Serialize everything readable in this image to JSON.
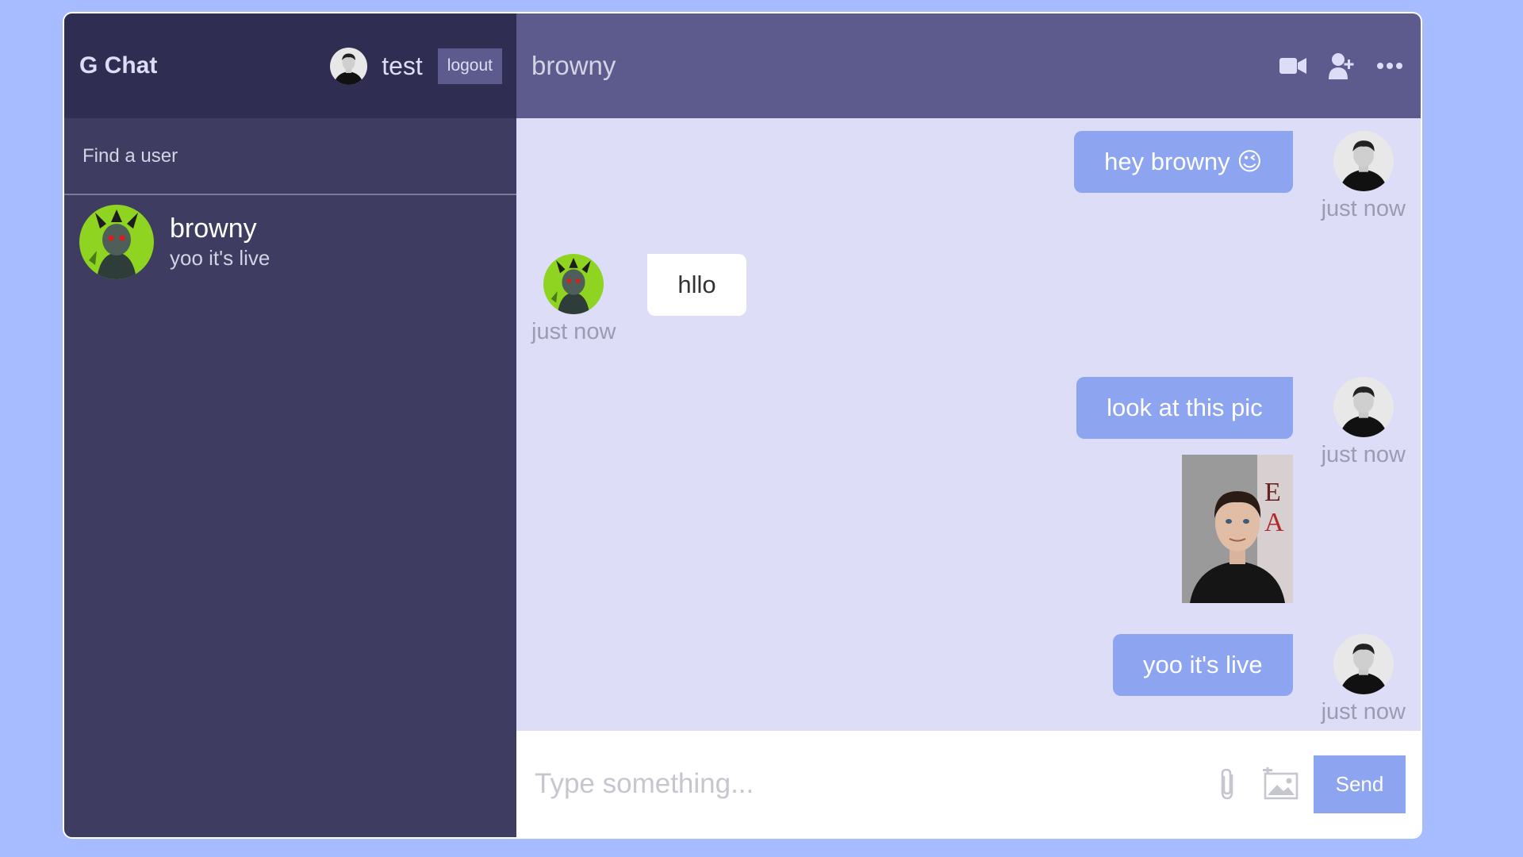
{
  "sidebar": {
    "app_title": "G Chat",
    "current_user": {
      "name": "test"
    },
    "logout_label": "logout",
    "search_placeholder": "Find a user",
    "chats": [
      {
        "name": "browny",
        "last_message": "yoo it's live"
      }
    ]
  },
  "chat": {
    "title": "browny",
    "icons": [
      "video-camera-icon",
      "add-user-icon",
      "more-options-icon"
    ],
    "messages": [
      {
        "owner": true,
        "text": "hey browny 😉",
        "time": "just now"
      },
      {
        "owner": false,
        "text": "hllo",
        "time": "just now"
      },
      {
        "owner": true,
        "text": "look at this pic",
        "time": "just now",
        "has_image": true
      },
      {
        "owner": true,
        "text": "yoo it's live",
        "time": "just now"
      }
    ],
    "input_placeholder": "Type something...",
    "send_label": "Send"
  },
  "colors": {
    "page_background": "#a7bcff",
    "sidebar": "#3e3c61",
    "sidebar_header": "#2f2d52",
    "chat_header": "#5d5b8d",
    "messages_background": "#ddddf7",
    "owner_bubble": "#8da4f1"
  }
}
